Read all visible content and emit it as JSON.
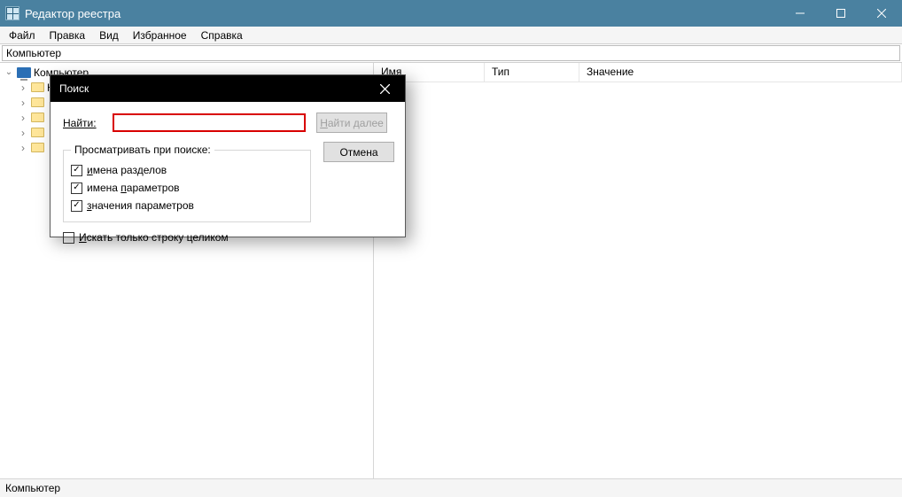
{
  "window": {
    "title": "Редактор реестра",
    "menubar": [
      "Файл",
      "Правка",
      "Вид",
      "Избранное",
      "Справка"
    ],
    "address": "Компьютер",
    "statusbar": "Компьютер"
  },
  "tree": {
    "root": "Компьютер",
    "children": [
      "HKEY_CLASSES_ROOT"
    ]
  },
  "list": {
    "columns": [
      "Имя",
      "Тип",
      "Значение"
    ]
  },
  "dialog": {
    "title": "Поиск",
    "find_label": "Найти:",
    "find_value": "",
    "find_next_btn": "Найти далее",
    "cancel_btn": "Отмена",
    "look_at_legend": "Просматривать при поиске:",
    "cb_keys": "мена разделов",
    "cb_keys_prefix": "и",
    "cb_values": "имена ",
    "cb_values_suffix": "араметров",
    "cb_values_u": "п",
    "cb_data_prefix": "з",
    "cb_data": "начения параметров",
    "cb_whole_prefix": "И",
    "cb_whole": "скать только строку целиком",
    "cb_keys_checked": true,
    "cb_values_checked": true,
    "cb_data_checked": true,
    "cb_whole_checked": false
  }
}
